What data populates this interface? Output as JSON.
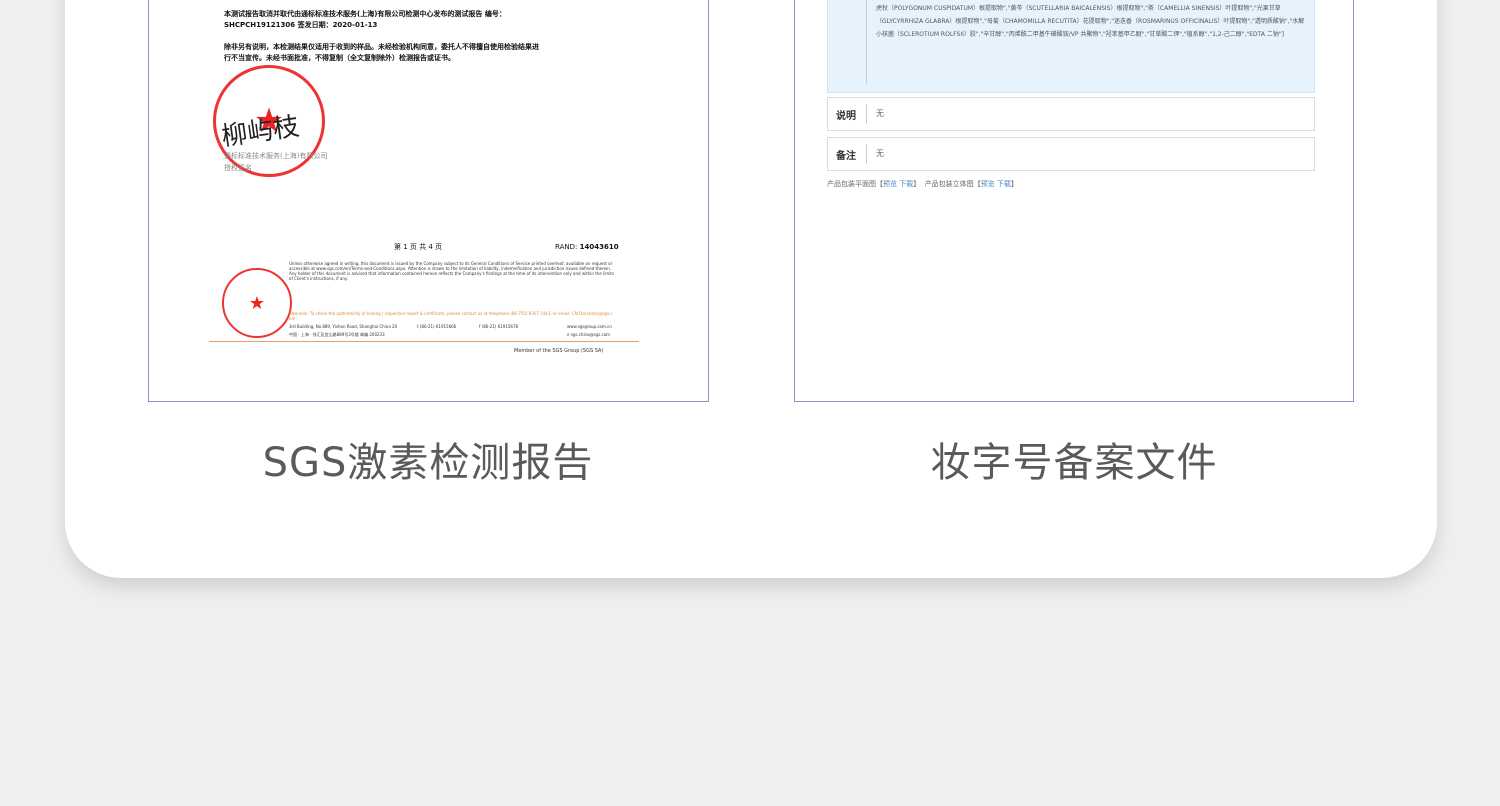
{
  "documents": [
    {
      "caption": "SGS激素检测报告",
      "lines": [
        "本测试报告取消并取代由通标标准技术服务(上海)有限公司检测中心发布的测试报告 编号：",
        "SHCPCH19121306 签发日期：2020-01-13",
        "除非另有说明，本检测结果仅适用于收到的样品。未经检验机构同意，委托人不得擅自使用检验结果进",
        "行不当宣传。未经书面批准，不得复制（全文复制除外）检测报告或证书。"
      ],
      "signature": "柳屿枝",
      "company": "通标标准技术服务(上海)有限公司",
      "authorized": "授权签名",
      "page_info": "第 1 页 共 4 页",
      "rand_label": "RAND:",
      "rand_value": "14043610",
      "fine_print": "Unless otherwise agreed in writing, this document is issued by the Company subject to its General Conditions of Service printed overleaf, available on request or accessible at www.sgs.com/en/Terms-and-Conditions.aspx. Attention is drawn to the limitation of liability, indemnification and jurisdiction issues defined therein. Any holder of this document is advised that information contained hereon reflects the Company's findings at the time of its intervention only and within the limits of Client's instructions, if any.",
      "attention": "Attention: To check the authenticity of testing / inspection report & certificate, please contact us at telephone (86-755) 8307 1443, or email: CN.Doccheck@sgs.com",
      "address_en": "3rd Building, No.889, Yishan Road, Shanghai China 200233",
      "address_cn": "中国 · 上海 · 徐汇区宜山路889号3号楼 邮编 200233",
      "phone1": "t (86-21) 61915666",
      "phone2": "f (86-21) 61915678",
      "web": "www.sgsgroup.com.cn",
      "email": "e sgs.china@sgs.com",
      "member": "Member of the SGS Group (SGS SA)"
    },
    {
      "caption": "妆字号备案文件",
      "ingredients": "虎杖（POLYGONUM CUSPIDATUM）根提取物\",\"黄芩（SCUTELLARIA BAICALENSIS）根提取物\",\"茶（CAMELLIA SINENSIS）叶提取物\",\"光果甘草（GLYCYRRHIZA GLABRA）根提取物\",\"母菊（CHAMOMILLA RECUTITA）花提取物\",\"迷迭香（ROSMARINUS OFFICINALIS）叶提取物\",\"透明质酸钠\",\"水解小核菌（SCLEROTIUM ROLFSII）胶\",\"辛甘醇\",\"丙烯酰二甲基牛磺酸铵/VP 共聚物\",\"羟苯基甲乙醚\",\"甘草酸二钾\",\"植系醇\",\"1,2-己二醇\",\"EDTA 二钠\"]",
      "rows": [
        {
          "key": "说明",
          "value": "无"
        },
        {
          "key": "备注",
          "value": "无"
        }
      ],
      "links": [
        {
          "label": "产品包装平面图",
          "view": "预览",
          "download": "下载"
        },
        {
          "label": "产品包装立体图",
          "view": "预览",
          "download": "下载"
        }
      ]
    }
  ]
}
